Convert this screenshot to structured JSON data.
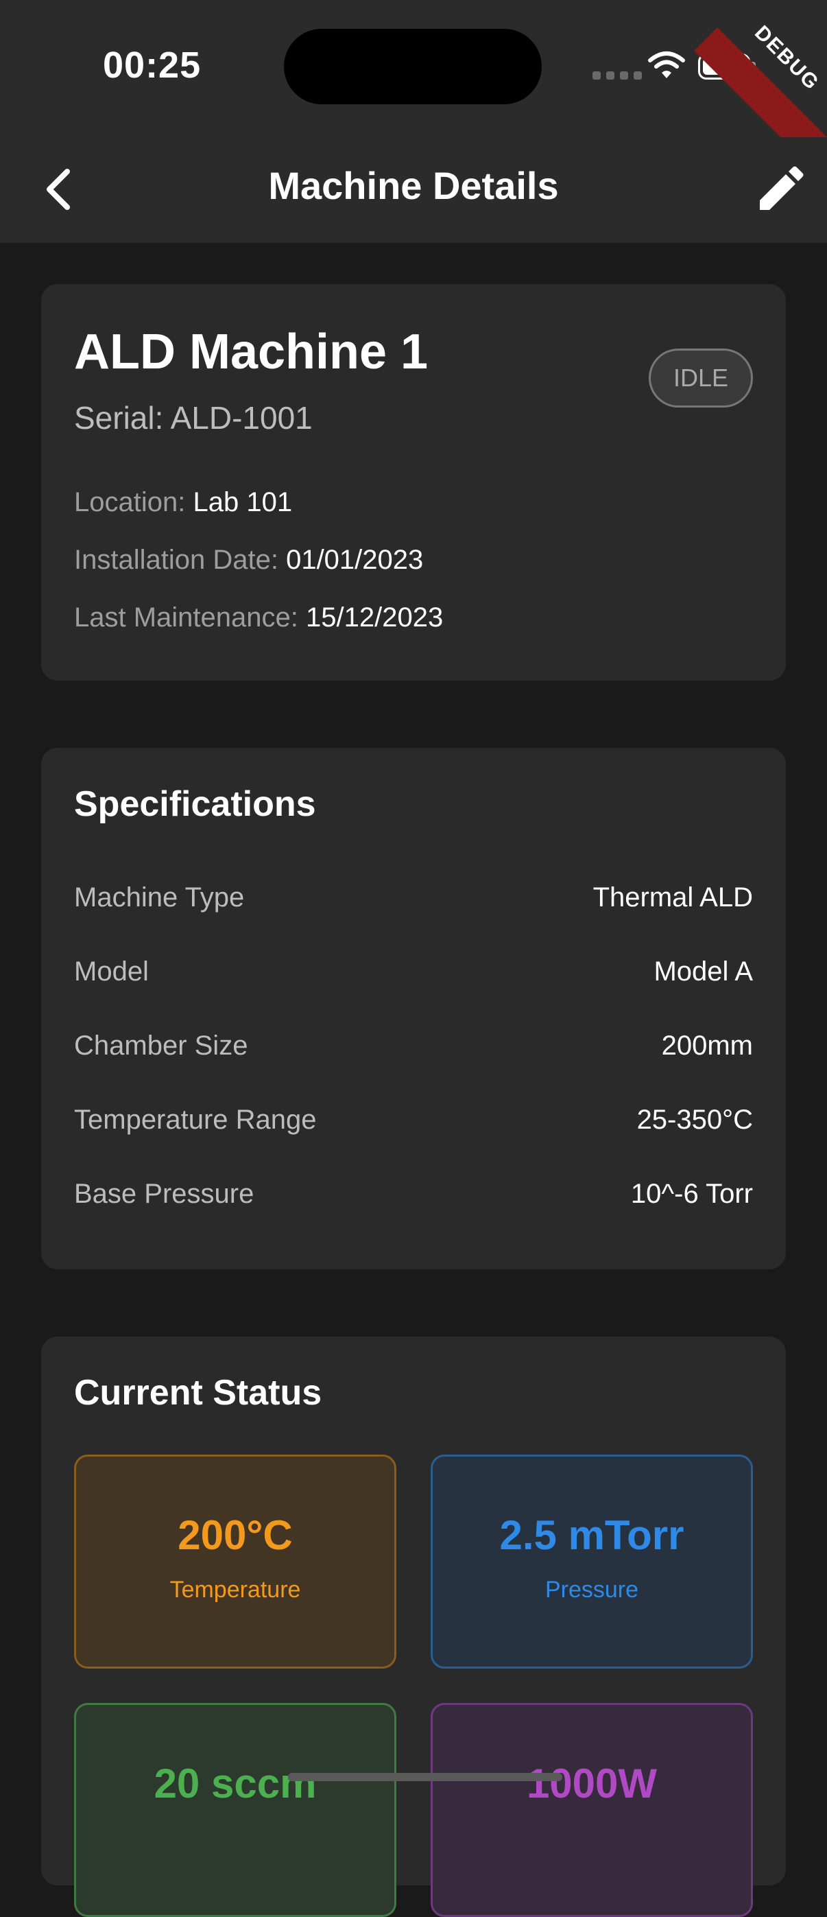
{
  "status_bar": {
    "time": "00:25",
    "debug_label": "DEBUG"
  },
  "app_bar": {
    "title": "Machine Details",
    "back_icon": "chevron-left-icon",
    "edit_icon": "pencil-icon"
  },
  "machine": {
    "name": "ALD Machine 1",
    "serial": "Serial: ALD-1001",
    "status": "IDLE",
    "location_label": "Location:",
    "location": "Lab 101",
    "install_label": "Installation Date:",
    "install_date": "01/01/2023",
    "maintenance_label": "Last Maintenance:",
    "maintenance_date": "15/12/2023"
  },
  "specifications": {
    "title": "Specifications",
    "rows": [
      {
        "key": "Machine Type",
        "value": "Thermal ALD"
      },
      {
        "key": "Model",
        "value": "Model A"
      },
      {
        "key": "Chamber Size",
        "value": "200mm"
      },
      {
        "key": "Temperature Range",
        "value": "25-350°C"
      },
      {
        "key": "Base Pressure",
        "value": "10^-6 Torr"
      }
    ]
  },
  "current_status": {
    "title": "Current Status",
    "tiles": [
      {
        "value": "200°C",
        "label": "Temperature",
        "color": "#f39a1e"
      },
      {
        "value": "2.5 mTorr",
        "label": "Pressure",
        "color": "#2e8ae6"
      },
      {
        "value": "20 sccm",
        "label": "",
        "color": "#4caf50"
      },
      {
        "value": "1000W",
        "label": "",
        "color": "#b04ac4"
      }
    ]
  }
}
